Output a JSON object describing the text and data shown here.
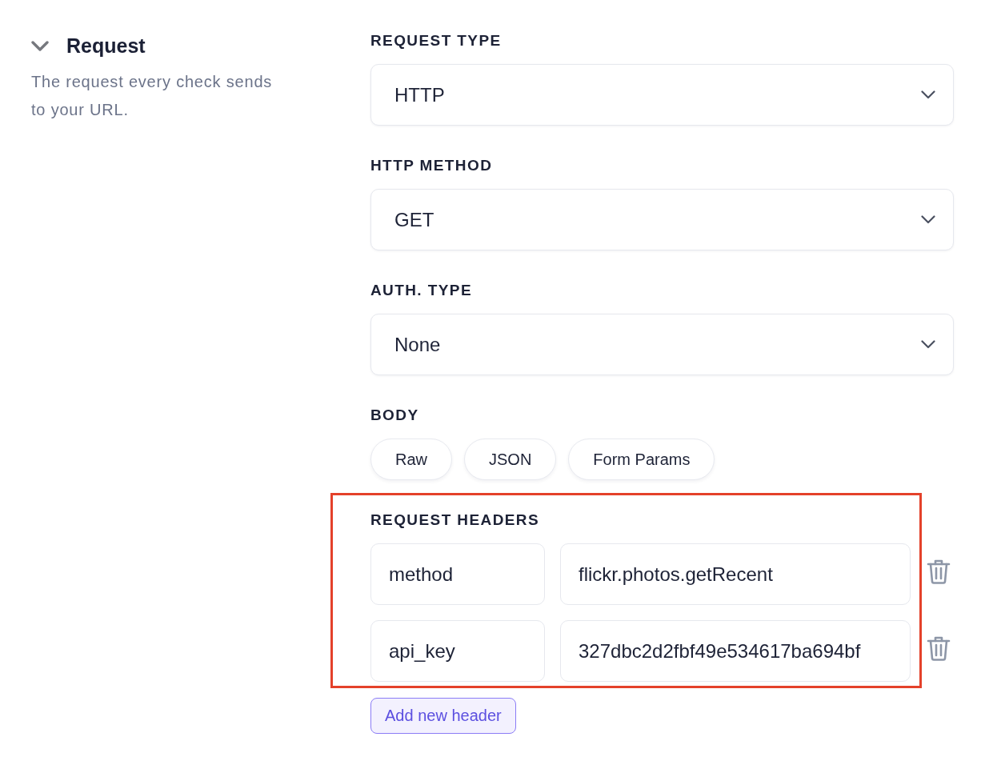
{
  "section": {
    "title": "Request",
    "expanded": true,
    "description": "The request every check sends to your URL."
  },
  "fields": [
    {
      "kind": "select",
      "label": "REQUEST TYPE",
      "value": "HTTP"
    },
    {
      "kind": "select",
      "label": "HTTP METHOD",
      "value": "GET"
    },
    {
      "kind": "select",
      "label": "AUTH. TYPE",
      "value": "None"
    },
    {
      "kind": "pills",
      "label": "BODY",
      "options": [
        {
          "label": "Raw",
          "selected": false
        },
        {
          "label": "JSON",
          "selected": false
        },
        {
          "label": "Form Params",
          "selected": false
        }
      ]
    }
  ],
  "request_headers": {
    "label": "REQUEST HEADERS",
    "highlighted": true,
    "rows": [
      {
        "key": "method",
        "value": "flickr.photos.getRecent"
      },
      {
        "key": "api_key",
        "value": "327dbc2d2fbf49e534617ba694bf"
      }
    ],
    "add_button": "Add new header"
  }
}
